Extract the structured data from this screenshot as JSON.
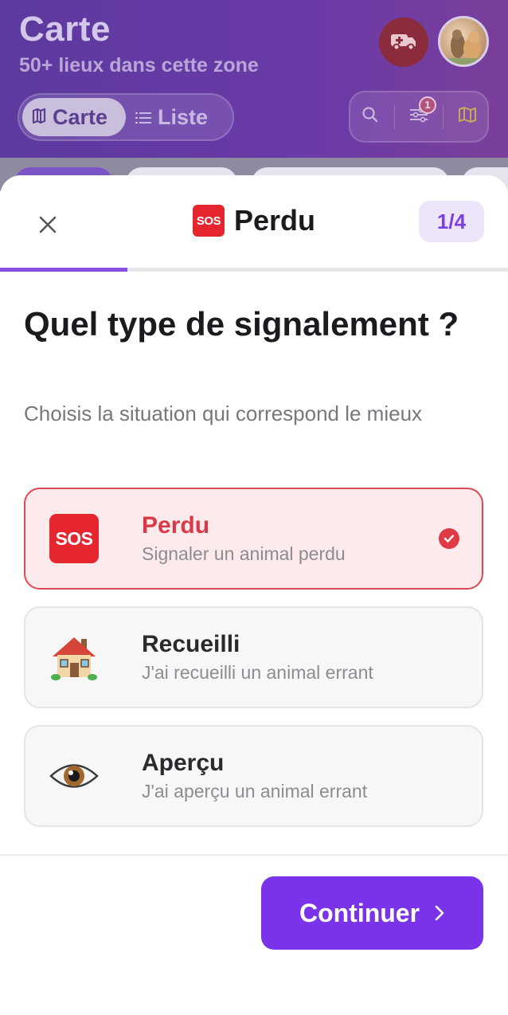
{
  "background": {
    "title": "Carte",
    "subtitle": "50+ lieux dans cette zone",
    "view_toggle": {
      "map_label": "Carte",
      "list_label": "Liste",
      "selected": "Carte"
    },
    "filter_badge_count": "1",
    "icons": [
      "ambulance-icon",
      "search-icon",
      "filter-icon",
      "map-icon",
      "map-fold-icon",
      "list-icon"
    ]
  },
  "sheet": {
    "emoji_label": "SOS",
    "title": "Perdu",
    "step": "1/4",
    "progress_fraction": 0.25,
    "question": "Quel type de signalement ?",
    "helper": "Choisis la situation qui correspond le mieux",
    "options": [
      {
        "emoji": "SOS",
        "title": "Perdu",
        "subtitle": "Signaler un animal perdu",
        "selected": true
      },
      {
        "emoji": "🏠",
        "title": "Recueilli",
        "subtitle": "J'ai recueilli un animal errant",
        "selected": false
      },
      {
        "emoji": "👁",
        "title": "Aperçu",
        "subtitle": "J'ai aperçu un animal errant",
        "selected": false
      }
    ],
    "continue_label": "Continuer"
  },
  "colors": {
    "accent": "#7a33e8",
    "selected_border": "#d94a56",
    "selected_bg": "#fdeaec",
    "sos_red": "#e5262f"
  }
}
